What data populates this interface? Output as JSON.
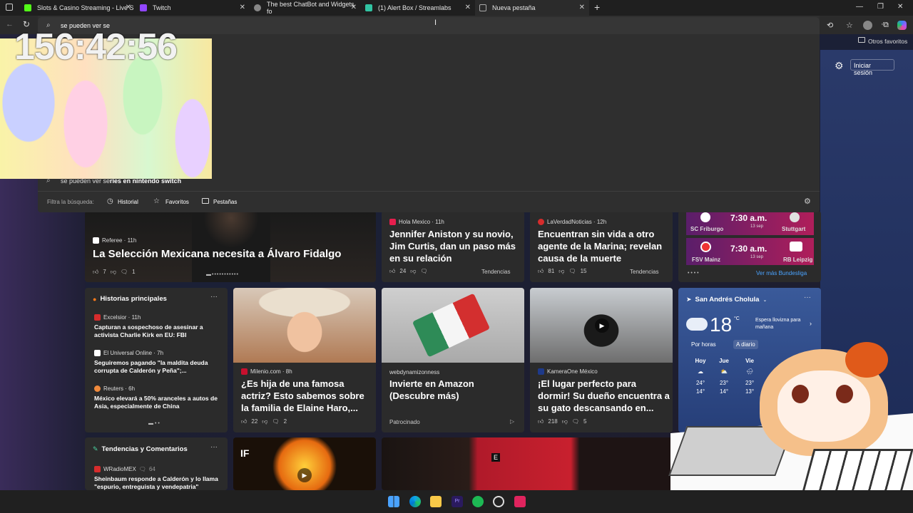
{
  "tabs": [
    {
      "label": "Slots & Casino Streaming - Live S",
      "color": "#53fc18"
    },
    {
      "label": "Twitch",
      "color": "#9146ff"
    },
    {
      "label": "The best ChatBot and Widgets fo",
      "color": "#888888"
    },
    {
      "label": "(1) Alert Box / Streamlabs",
      "color": "#31c3a2"
    },
    {
      "label": "Nueva pestaña",
      "color": "#888888"
    }
  ],
  "omnibox": {
    "query": "se pueden ver se",
    "suggestion_typed": "se pueden ver se",
    "suggestion_rest": "ries en nintendo switch",
    "filter_label": "Filtra la búsqueda:",
    "filters": [
      "Historial",
      "Favoritos",
      "Pestañas"
    ]
  },
  "bookmarks": {
    "other": "Otros favoritos"
  },
  "signin": "Iniciar sesión",
  "overlay": {
    "clock": "156:42:56"
  },
  "hero": {
    "source": "Referee · 11h",
    "title": "La Selección Mexicana necesita a Álvaro Fidalgo",
    "likes": "7",
    "comments": "1"
  },
  "card2": {
    "source": "Hola Mexico · 11h",
    "title": "Jennifer Aniston y su novio, Jim Curtis, dan un paso más en su relación",
    "likes": "24",
    "trend": "Tendencias"
  },
  "card3": {
    "source": "LaVerdadNoticias · 12h",
    "title": "Encuentran sin vida a otro agente de la Marina; revelan causa de la muerte",
    "likes": "81",
    "comments": "15",
    "trend": "Tendencias"
  },
  "sports": {
    "matches": [
      {
        "home": "SC Friburgo",
        "time": "7:30 a.m.",
        "date": "13 sep",
        "away": "Stuttgart"
      },
      {
        "home": "FSV Mainz",
        "time": "7:30 a.m.",
        "date": "13 sep",
        "away": "RB Leipzig"
      }
    ],
    "more": "Ver más Bundesliga"
  },
  "top_stories": {
    "heading": "Historias principales",
    "items": [
      {
        "source": "Excelsior · 11h",
        "headline": "Capturan a sospechoso de asesinar a activista Charlie Kirk en EU: FBI"
      },
      {
        "source": "El Universal Online · 7h",
        "headline": "Seguiremos pagando \"la maldita deuda corrupta de Calderón y Peña\";..."
      },
      {
        "source": "Reuters · 6h",
        "headline": "México elevará a 50% aranceles a autos de Asia, especialmente de China"
      }
    ]
  },
  "card_milenio": {
    "source": "Milenio.com · 8h",
    "title": "¿Es hija de una famosa actriz? Esto sabemos sobre la familia de Elaine Haro,...",
    "likes": "22",
    "comments": "2"
  },
  "card_amazon": {
    "source": "webdynamizonness",
    "title": "Invierte en Amazon (Descubre más)",
    "sponsored": "Patrocinado"
  },
  "card_cat": {
    "source": "KameraOne México",
    "title": "¡El lugar perfecto para dormir! Su dueño encuentra a su gato descansando en...",
    "likes": "218",
    "comments": "5"
  },
  "weather": {
    "location": "San Andrés Cholula",
    "temp": "18",
    "unit": "°C",
    "forecast": "Espera llovizna para mañana",
    "tabs": [
      "Por horas",
      "A diario"
    ],
    "days": [
      {
        "day": "Hoy",
        "hi": "24°",
        "lo": "14°"
      },
      {
        "day": "Jue",
        "hi": "23°",
        "lo": "14°"
      },
      {
        "day": "Vie",
        "hi": "23°",
        "lo": "13°"
      }
    ]
  },
  "trending": {
    "heading": "Tendencias y Comentarios",
    "source": "WRadioMEX",
    "count": "64",
    "headline": "Sheinbaum responde a Calderón y lo llama \"espurio, entreguista y vendepatria\""
  },
  "colors": {
    "accent": "#4aa3ff",
    "brand_edge": "#0078d4"
  }
}
